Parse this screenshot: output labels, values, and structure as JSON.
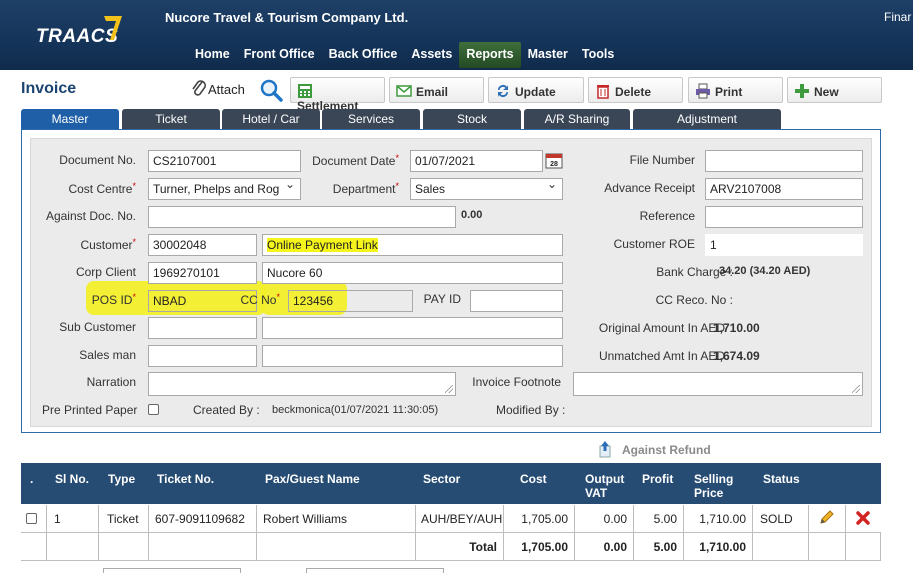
{
  "header": {
    "logo": "TRAACS",
    "company": "Nucore Travel & Tourism Company Ltd.",
    "corner_text": "Finar",
    "nav": [
      "Home",
      "Front Office",
      "Back Office",
      "Assets",
      "Reports",
      "Master",
      "Tools"
    ],
    "active_nav": "Reports"
  },
  "toolbar": {
    "title": "Invoice",
    "attach": "Attach",
    "buttons": [
      "Settlement",
      "Email",
      "Update",
      "Delete",
      "Print",
      "New"
    ]
  },
  "tabs": [
    "Master",
    "Ticket",
    "Hotel / Car",
    "Services",
    "Stock",
    "A/R Sharing",
    "Adjustment"
  ],
  "form": {
    "document_no_label": "Document No.",
    "document_no": "CS2107001",
    "document_date_label": "Document Date",
    "document_date": "01/07/2021",
    "calendar_day": "28",
    "file_number_label": "File Number",
    "file_number": "",
    "cost_centre_label": "Cost Centre",
    "cost_centre": "Turner, Phelps and Rog",
    "department_label": "Department",
    "department": "Sales",
    "advance_receipt_label": "Advance Receipt",
    "advance_receipt": "ARV2107008",
    "against_doc_label": "Against Doc. No.",
    "against_doc": "",
    "against_doc_amount": "0.00",
    "reference_label": "Reference",
    "reference": "",
    "customer_label": "Customer",
    "customer_code": "30002048",
    "customer_name": "Online Payment Link",
    "customer_roe_label": "Customer ROE",
    "customer_roe": "1",
    "corp_client_label": "Corp Client",
    "corp_client_code": "1969270101",
    "corp_client_name": "Nucore 60",
    "bank_charge_label": "Bank Charge :",
    "bank_charge": "34.20 (34.20 AED)",
    "pos_id_label": "POS ID",
    "pos_id": "NBAD",
    "cc_no_label": "CC No",
    "cc_no": "123456",
    "pay_id_label": "PAY ID",
    "pay_id": "",
    "cc_reco_label": "CC Reco. No :",
    "sub_customer_label": "Sub Customer",
    "original_amount_label": "Original Amount In AED",
    "original_amount": "1,710.00",
    "sales_man_label": "Sales man",
    "unmatched_label": "Unmatched Amt In AED",
    "unmatched_amount": "1,674.09",
    "narration_label": "Narration",
    "invoice_footnote_label": "Invoice Footnote",
    "pre_printed_label": "Pre Printed Paper",
    "created_by_label": "Created By :",
    "created_by": "beckmonica(01/07/2021 11:30:05)",
    "modified_by_label": "Modified By :"
  },
  "refund": {
    "label": "Against Refund"
  },
  "grid": {
    "headers": [
      ".",
      "Sl No.",
      "Type",
      "Ticket No.",
      "Pax/Guest Name",
      "Sector",
      "Cost",
      "Output VAT",
      "Profit",
      "Selling Price",
      "Status"
    ],
    "rows": [
      {
        "sl": "1",
        "type": "Ticket",
        "ticket_no": "607-9091109682",
        "pax": "Robert Williams",
        "sector": "AUH/BEY/AUH",
        "cost": "1,705.00",
        "vat": "0.00",
        "profit": "5.00",
        "selling": "1,710.00",
        "status": "SOLD"
      }
    ],
    "total": {
      "label": "Total",
      "cost": "1,705.00",
      "vat": "0.00",
      "profit": "5.00",
      "selling": "1,710.00"
    }
  }
}
